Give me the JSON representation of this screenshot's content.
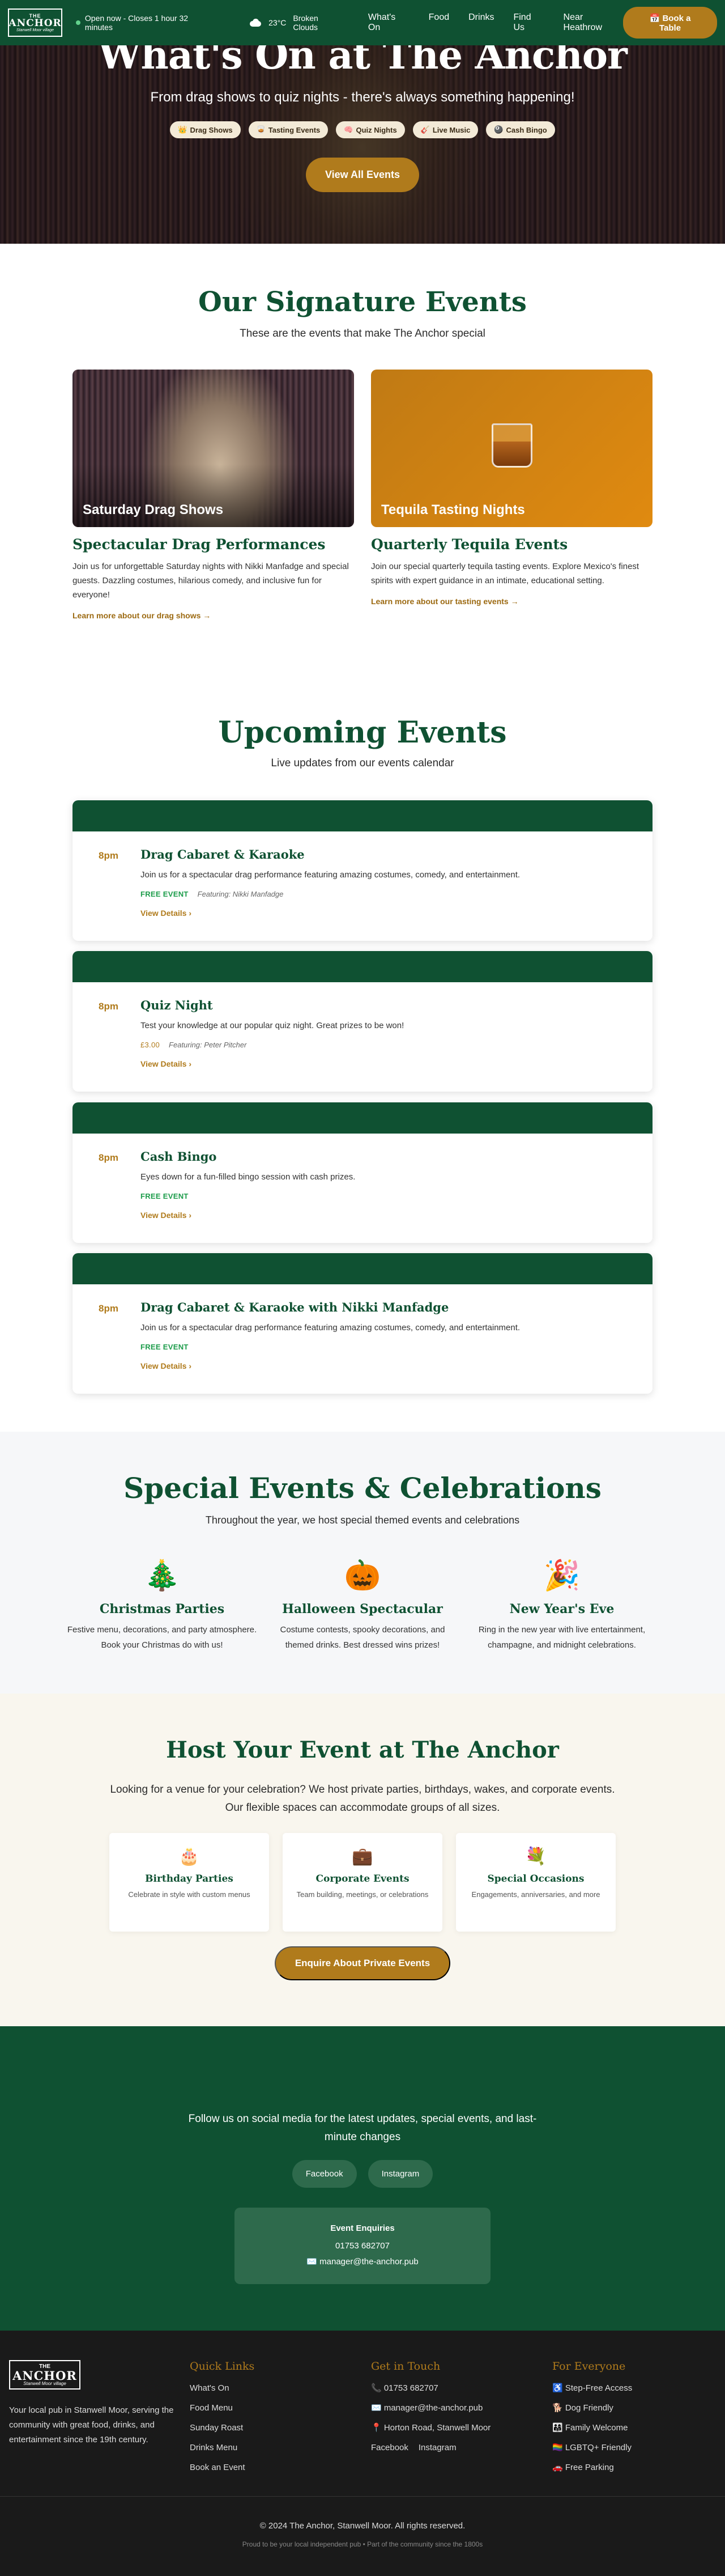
{
  "nav": {
    "logo": {
      "line1": "THE",
      "line2": "ANCHOR",
      "line3": "Stanwell Moor village"
    },
    "status": "Open now - Closes 1 hour 32 minutes",
    "weather": {
      "temp": "23°C",
      "condition": "Broken Clouds",
      "icon": "cloud-icon"
    },
    "links": [
      "What's On",
      "Food",
      "Drinks",
      "Find Us",
      "Near Heathrow"
    ],
    "book_label": "📅 Book a Table"
  },
  "hero": {
    "title": "What's On at The Anchor",
    "subtitle": "From drag shows to quiz nights - there's always something happening!",
    "tags": [
      {
        "icon": "👑",
        "label": "Drag Shows"
      },
      {
        "icon": "🥃",
        "label": "Tasting Events"
      },
      {
        "icon": "🧠",
        "label": "Quiz Nights"
      },
      {
        "icon": "🎸",
        "label": "Live Music"
      },
      {
        "icon": "🎱",
        "label": "Cash Bingo"
      }
    ],
    "button": "View All Events"
  },
  "signature": {
    "title": "Our Signature Events",
    "subtitle": "These are the events that make The Anchor special",
    "cards": [
      {
        "caption": "Saturday Drag Shows",
        "heading": "Spectacular Drag Performances",
        "text": "Join us for unforgettable Saturday nights with Nikki Manfadge and special guests. Dazzling costumes, hilarious comedy, and inclusive fun for everyone!",
        "link": "Learn more about our drag shows →"
      },
      {
        "caption": "Tequila Tasting Nights",
        "heading": "Quarterly Tequila Events",
        "text": "Join our special quarterly tequila tasting events. Explore Mexico's finest spirits with expert guidance in an intimate, educational setting.",
        "link": "Learn more about our tasting events →"
      }
    ]
  },
  "upcoming": {
    "title": "Upcoming Events",
    "subtitle": "Live updates from our events calendar",
    "view_label": "View Details",
    "events": [
      {
        "time": "8pm",
        "title": "Drag Cabaret & Karaoke",
        "desc": "Join us for a spectacular drag performance featuring amazing costumes, comedy, and entertainment.",
        "price": "FREE EVENT",
        "featuring": "Featuring: Nikki Manfadge"
      },
      {
        "time": "8pm",
        "title": "Quiz Night",
        "desc": "Test your knowledge at our popular quiz night. Great prizes to be won!",
        "price": "£3.00",
        "featuring": "Featuring: Peter Pitcher"
      },
      {
        "time": "8pm",
        "title": "Cash Bingo",
        "desc": "Eyes down for a fun-filled bingo session with cash prizes.",
        "price": "FREE EVENT",
        "featuring": ""
      },
      {
        "time": "8pm",
        "title": "Drag Cabaret & Karaoke with Nikki Manfadge",
        "desc": "Join us for a spectacular drag performance featuring amazing costumes, comedy, and entertainment.",
        "price": "FREE EVENT",
        "featuring": ""
      }
    ]
  },
  "special": {
    "title": "Special Events & Celebrations",
    "subtitle": "Throughout the year, we host special themed events and celebrations",
    "items": [
      {
        "icon": "🎄",
        "title": "Christmas Parties",
        "text": "Festive menu, decorations, and party atmosphere. Book your Christmas do with us!"
      },
      {
        "icon": "🎃",
        "title": "Halloween Spectacular",
        "text": "Costume contests, spooky decorations, and themed drinks. Best dressed wins prizes!"
      },
      {
        "icon": "🎉",
        "title": "New Year's Eve",
        "text": "Ring in the new year with live entertainment, champagne, and midnight celebrations."
      }
    ]
  },
  "host": {
    "title": "Host Your Event at The Anchor",
    "subtitle": "Looking for a venue for your celebration? We host private parties, birthdays, wakes, and corporate events. Our flexible spaces can accommodate groups of all sizes.",
    "boxes": [
      {
        "icon": "🎂",
        "title": "Birthday Parties",
        "text": "Celebrate in style with custom menus"
      },
      {
        "icon": "💼",
        "title": "Corporate Events",
        "text": "Team building, meetings, or celebrations"
      },
      {
        "icon": "💐",
        "title": "Special Occasions",
        "text": "Engagements, anniversaries, and more"
      }
    ],
    "button": "Enquire About Private Events"
  },
  "social": {
    "text": "Follow us on social media for the latest updates, special events, and last-minute changes",
    "buttons": [
      "Facebook",
      "Instagram"
    ],
    "enquiries": {
      "title": "Event Enquiries",
      "phone": "01753 682707",
      "email": "✉️ manager@the-anchor.pub"
    }
  },
  "footer": {
    "logo": {
      "line1": "THE",
      "line2": "ANCHOR",
      "line3": "Stanwell Moor village"
    },
    "about": "Your local pub in Stanwell Moor, serving the community with great food, drinks, and entertainment since the 19th century.",
    "quick_links": {
      "title": "Quick Links",
      "items": [
        "What's On",
        "Food Menu",
        "Sunday Roast",
        "Drinks Menu",
        "Book an Event"
      ]
    },
    "contact": {
      "title": "Get in Touch",
      "phone": "📞 01753 682707",
      "email": "✉️ manager@the-anchor.pub",
      "address": "📍 Horton Road, Stanwell Moor",
      "facebook": "Facebook",
      "instagram": "Instagram"
    },
    "everyone": {
      "title": "For Everyone",
      "items": [
        "♿ Step-Free Access",
        "🐕 Dog Friendly",
        "👨‍👩‍👧 Family Welcome",
        "🏳️‍🌈 LGBTQ+ Friendly",
        "🚗 Free Parking"
      ]
    },
    "copyright": "© 2024 The Anchor, Stanwell Moor. All rights reserved.",
    "tagline": "Proud to be your local independent pub • Part of the community since the 1800s"
  }
}
